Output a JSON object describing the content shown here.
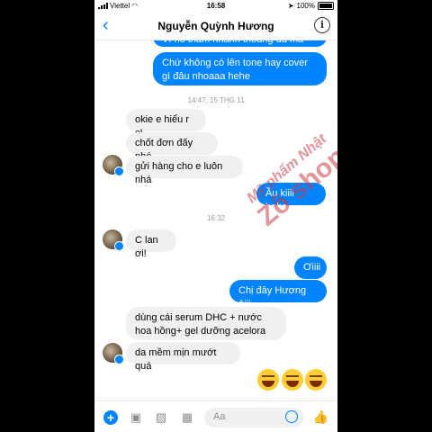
{
  "status_bar": {
    "carrier": "Viettel",
    "time": "16:58",
    "battery": "100%"
  },
  "header": {
    "back_glyph": "‹",
    "contact_name": "Nguyễn Quỳnh Hương",
    "info_glyph": "i"
  },
  "messages": {
    "out_1": "Vì nó thấm nhanh thoáng da mà",
    "out_2": "Chứ không có lên tone hay cover gì đâu nhoaaa hehe",
    "stamp_1": "14:47, 15 THG 11",
    "in_1": "okie e hiểu r c!",
    "in_2": "chốt đơn đấy nhé",
    "in_3": "gửi hàng cho e luôn nhá",
    "out_3": "Ầu kiiii hehe",
    "stamp_2": "16:32",
    "in_4": "C lan ơi!",
    "out_4": "Ơiiii",
    "out_5": "Chị đây Hương ôiii",
    "in_5": "dùng cái serum DHC + nước hoa hồng+ gel dưỡng acelora",
    "in_6": "da mềm mịn mướt quá"
  },
  "watermark": {
    "line1": "Mỹ phẩm Nhật",
    "line2": "Zô shop"
  },
  "composer": {
    "plus": "+",
    "placeholder": "Aa"
  },
  "colors": {
    "accent": "#0084ff",
    "incoming": "#f1f0f0"
  }
}
